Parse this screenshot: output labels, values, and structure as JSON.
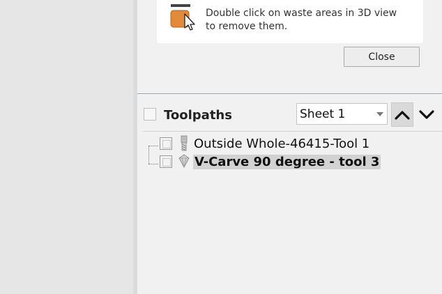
{
  "hint": {
    "text_line1": "Double click on waste areas in 3D view",
    "text_line2": "to remove them."
  },
  "buttons": {
    "close_label": "Close"
  },
  "toolpaths": {
    "header_title": "Toolpaths",
    "sheet_selected": "Sheet 1",
    "items": [
      {
        "label": "Outside Whole-46415-Tool 1",
        "icon": "end-mill-icon",
        "checked": false,
        "selected": false
      },
      {
        "label": "V-Carve 90 degree - tool 3",
        "icon": "v-bit-icon",
        "checked": false,
        "selected": true
      }
    ]
  },
  "colors": {
    "accent_rule": "#8da2b7",
    "selection": "#d2d2d2"
  }
}
